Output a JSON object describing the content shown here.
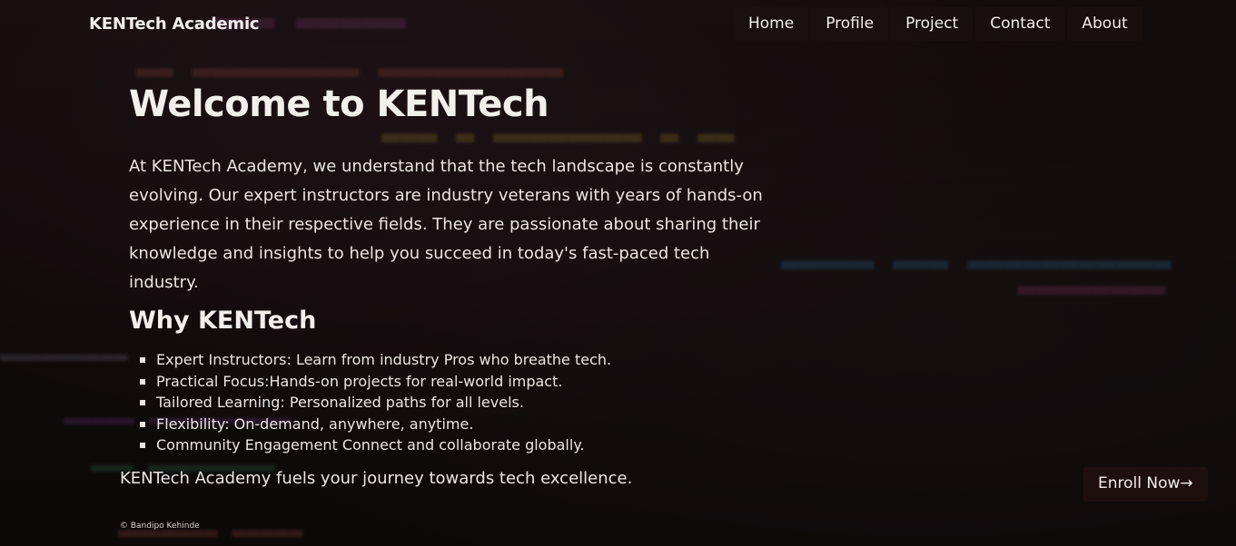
{
  "header": {
    "brand": "KENTech Academic",
    "nav": [
      "Home",
      "Profile",
      "Project",
      "Contact",
      "About"
    ]
  },
  "hero": {
    "title": "Welcome to KENTech",
    "intro": "At KENTech Academy, we understand that the tech landscape is constantly evolving. Our expert instructors are industry veterans with years of hands-on experience in their respective fields. They are passionate about sharing their knowledge and insights to help you succeed in today's fast-paced tech industry."
  },
  "why": {
    "title": "Why KENTech",
    "items": [
      "Expert Instructors: Learn from industry Pros who breathe tech.",
      "Practical Focus:Hands-on projects for real-world impact.",
      "Tailored Learning: Personalized paths for all levels.",
      "Flexibility: On-demand, anywhere, anytime.",
      "Community Engagement Connect and collaborate globally."
    ]
  },
  "tagline": "KENTech Academy fuels your journey towards tech excellence.",
  "cta": {
    "enroll_label": "Enroll Now→"
  },
  "footer": {
    "credit": "© Bandipo Kehinde"
  },
  "colors": {
    "background": "#15100f",
    "text": "#ebe6e3",
    "nav_bg": "#1e1212"
  }
}
